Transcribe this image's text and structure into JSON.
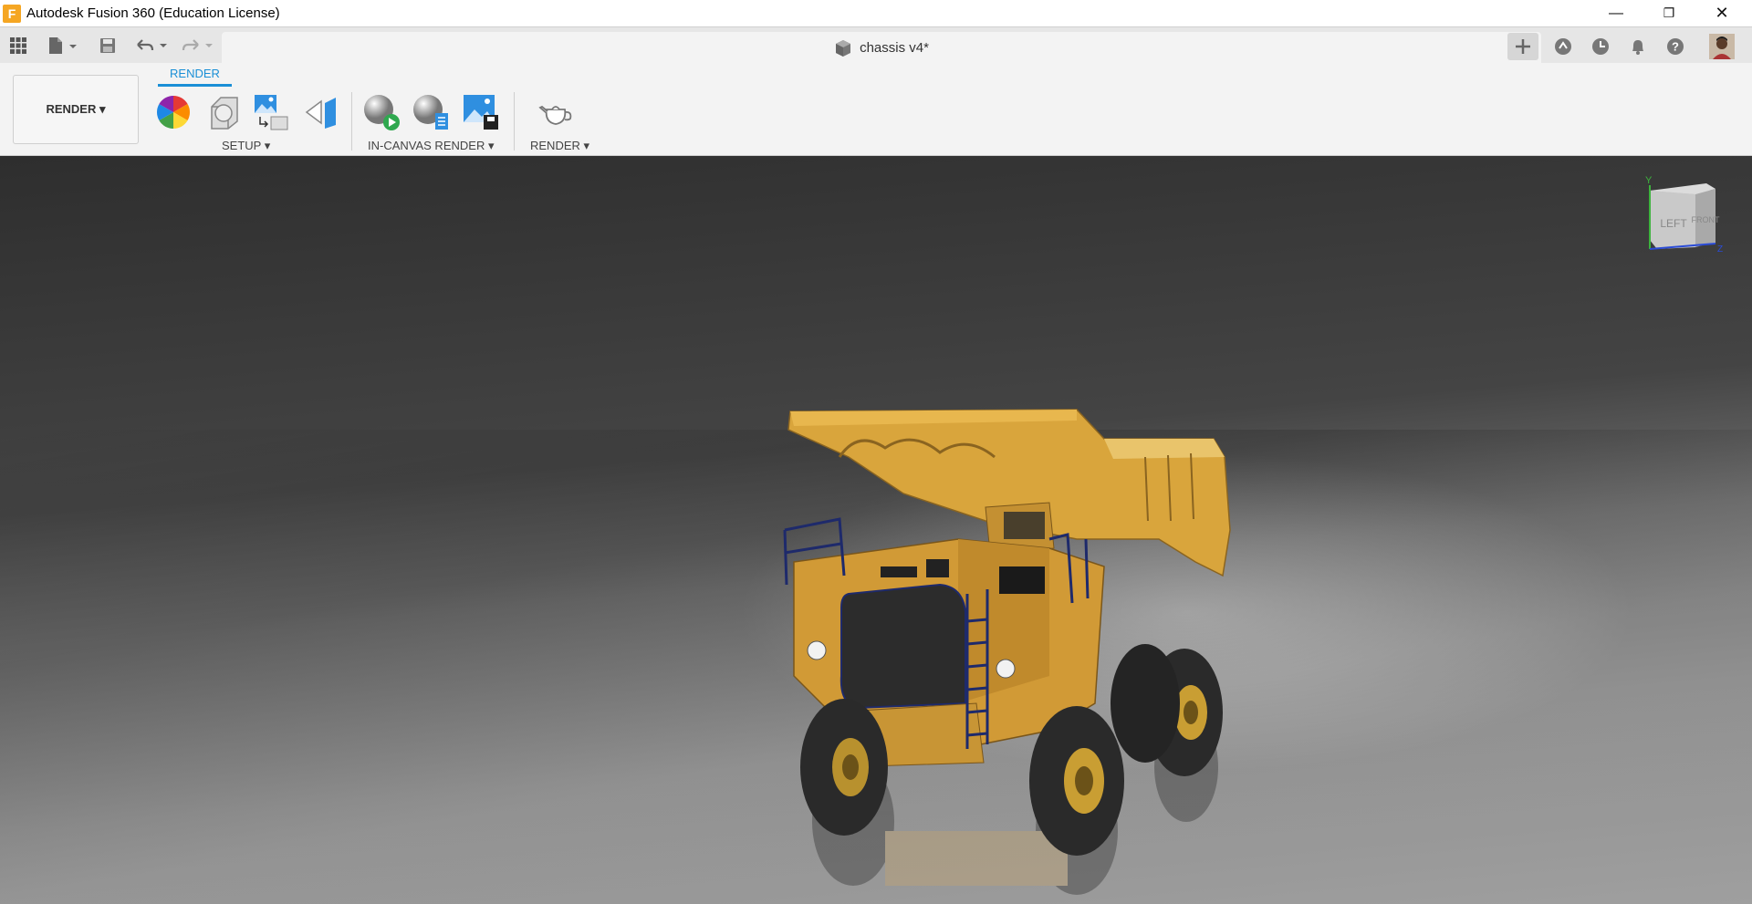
{
  "app": {
    "title": "Autodesk Fusion 360 (Education License)",
    "icon_letter": "F"
  },
  "window_controls": {
    "minimize": "—",
    "restore": "❐",
    "close": "✕"
  },
  "document": {
    "tab_title": "chassis v4*",
    "close_glyph": "✕"
  },
  "ribbon": {
    "workspace_label": "RENDER ▾",
    "active_tab": "RENDER",
    "groups": {
      "setup": "SETUP ▾",
      "in_canvas": "IN-CANVAS RENDER ▾",
      "render": "RENDER ▾"
    }
  },
  "viewcube": {
    "face_left": "LEFT",
    "face_front": "FRONT",
    "axis_y": "Y",
    "axis_z": "Z"
  },
  "colors": {
    "accent": "#1a8fd6",
    "truck_body": "#d9a53c",
    "truck_dark": "#8a6420",
    "tire": "#2a2a2a",
    "rail": "#1e2a6b"
  }
}
